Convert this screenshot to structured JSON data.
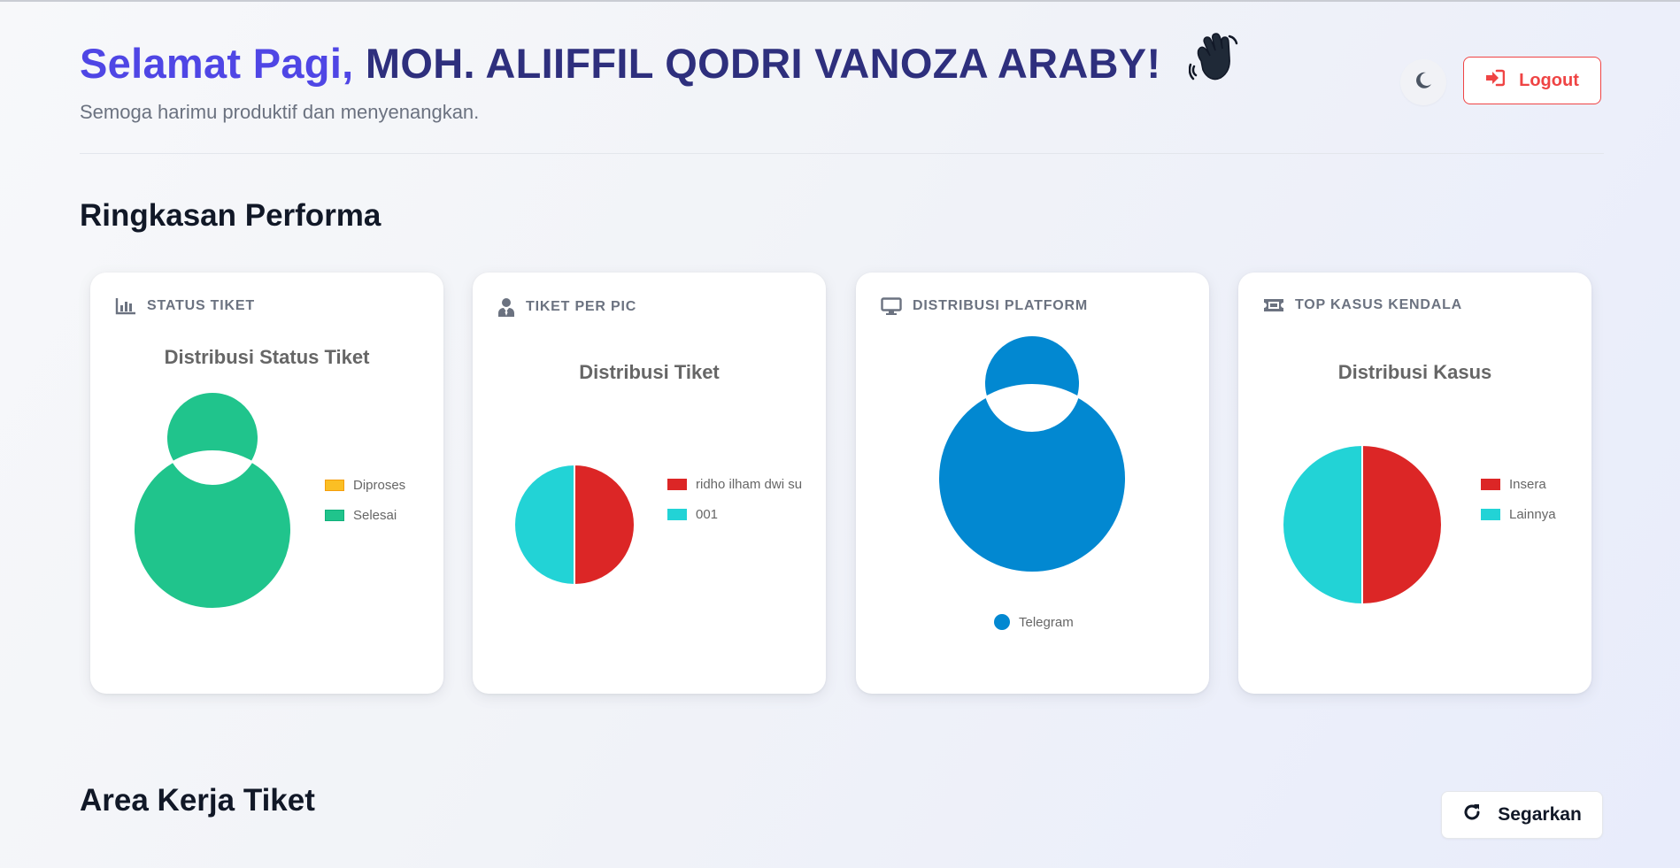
{
  "header": {
    "greeting_prefix": "Selamat Pagi,",
    "user_name": "MOH. ALIIFFIL QODRI VANOZA ARABY!",
    "subtitle": "Semoga harimu produktif dan menyenangkan.",
    "logout_label": "Logout"
  },
  "sections": {
    "summary_title": "Ringkasan Performa",
    "workspace_title": "Area Kerja Tiket",
    "refresh_label": "Segarkan"
  },
  "cards": [
    {
      "label": "STATUS TIKET",
      "icon": "bar-chart-icon"
    },
    {
      "label": "TIKET PER PIC",
      "icon": "user-tie-icon"
    },
    {
      "label": "DISTRIBUSI PLATFORM",
      "icon": "monitor-icon"
    },
    {
      "label": "TOP KASUS KENDALA",
      "icon": "ticket-icon"
    }
  ],
  "colors": {
    "accent": "#4f46e5",
    "accent_dark": "#2e2f7d",
    "danger": "#ef4444"
  },
  "chart_data": [
    {
      "type": "pie",
      "variant": "doughnut",
      "title": "Distribusi Status Tiket",
      "categories": [
        "Diproses",
        "Selesai"
      ],
      "values": [
        0,
        1
      ],
      "colors": [
        "#fbbf24",
        "#20c48c"
      ],
      "legend": "right"
    },
    {
      "type": "pie",
      "title": "Distribusi Tiket",
      "categories": [
        "ridho ilham dwi su",
        "001"
      ],
      "values": [
        1,
        1
      ],
      "colors": [
        "#dc2626",
        "#22d3d6"
      ],
      "legend": "right"
    },
    {
      "type": "pie",
      "variant": "doughnut",
      "title": "",
      "categories": [
        "Telegram"
      ],
      "values": [
        1
      ],
      "colors": [
        "#0288d1"
      ],
      "legend": "bottom"
    },
    {
      "type": "pie",
      "title": "Distribusi Kasus",
      "categories": [
        "Insera",
        "Lainnya"
      ],
      "values": [
        1,
        1
      ],
      "colors": [
        "#dc2626",
        "#22d3d6"
      ],
      "legend": "right"
    }
  ]
}
